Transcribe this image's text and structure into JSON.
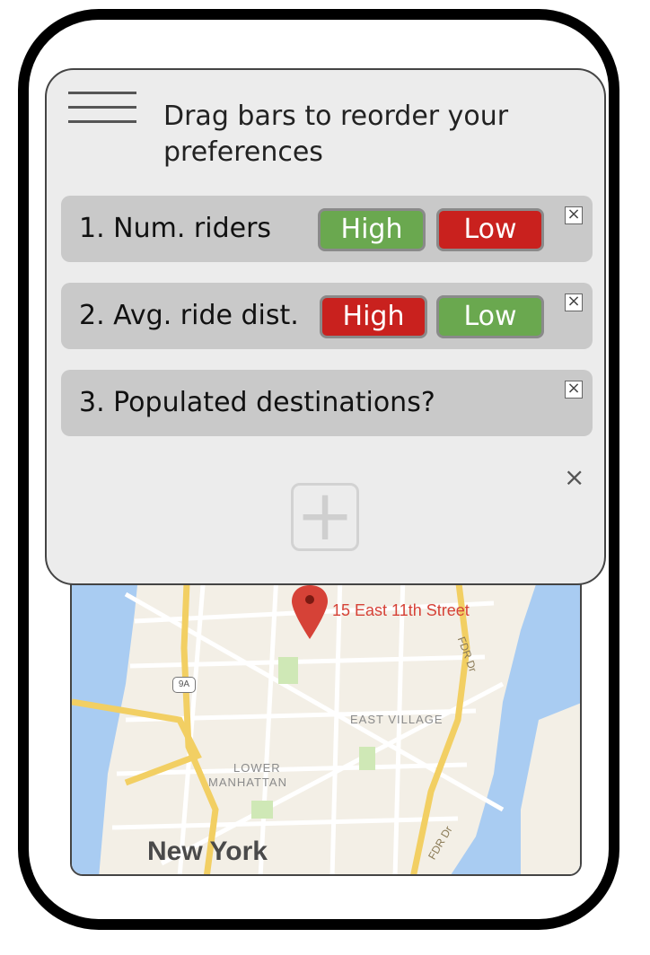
{
  "header": {
    "instruction": "Drag bars to reorder your preferences"
  },
  "preferences": [
    {
      "label": "1. Num. riders",
      "high_label": "High",
      "low_label": "Low",
      "close": "×"
    },
    {
      "label": "2. Avg. ride dist.",
      "high_label": "High",
      "low_label": "Low",
      "close": "×"
    },
    {
      "label": "3. Populated destinations?",
      "close": "×"
    }
  ],
  "add_row": {
    "close": "×",
    "add_symbol": "+"
  },
  "map": {
    "pin_label": "15 East 11th Street",
    "area_1": "EAST VILLAGE",
    "area_2_line1": "LOWER",
    "area_2_line2": "MANHATTAN",
    "city": "New York",
    "road_1": "FDR Dr",
    "road_2": "FDR Dr",
    "route": "9A"
  },
  "colors": {
    "high_green": "#6aa84f",
    "low_red": "#c9211e",
    "water": "#a9ccf2",
    "pin": "#d64237"
  }
}
